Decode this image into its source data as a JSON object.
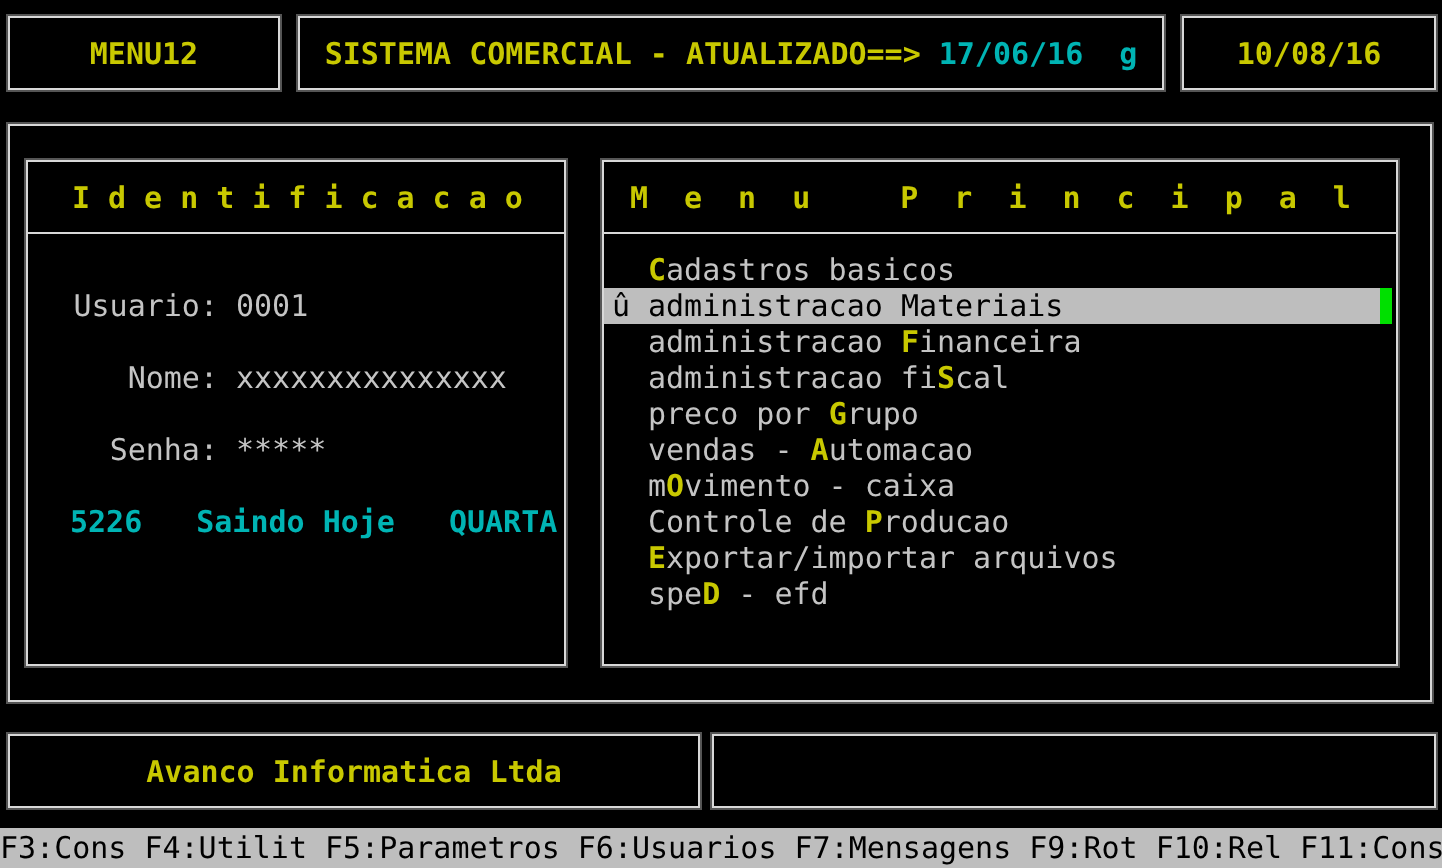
{
  "header": {
    "menu_code": "MENU12",
    "title": "SISTEMA COMERCIAL - ATUALIZADO==>",
    "updated_date": "17/06/16",
    "flag": "g",
    "current_date": "10/08/16"
  },
  "identification": {
    "title": "Identificacao",
    "fields": [
      {
        "label": "Usuario:",
        "value": "0001"
      },
      {
        "label": "Nome:",
        "value": "xxxxxxxxxxxxxxx"
      },
      {
        "label": "Senha:",
        "value": "*****"
      }
    ],
    "status": [
      "5226",
      "Saindo Hoje",
      "QUARTA"
    ]
  },
  "main_menu": {
    "title": "Menu Principal",
    "cursor_marker": "û",
    "items": [
      {
        "label": "**C**adastros basicos",
        "selected": false
      },
      {
        "label": "administracao **M**ateriais",
        "selected": true
      },
      {
        "label": "administracao **F**inanceira",
        "selected": false
      },
      {
        "label": "administracao fi**S**cal",
        "selected": false
      },
      {
        "label": "preco por **G**rupo",
        "selected": false
      },
      {
        "label": "vendas - **A**utomacao",
        "selected": false
      },
      {
        "label": "m**O**vimento - caixa",
        "selected": false
      },
      {
        "label": "Controle de **P**roducao",
        "selected": false
      },
      {
        "label": "**E**xportar/importar arquivos",
        "selected": false
      },
      {
        "label": "spe**D** - efd",
        "selected": false
      }
    ]
  },
  "footer": {
    "company": "Avanco Informatica Ltda"
  },
  "function_keys": [
    "F3:Cons",
    "F4:Utilit",
    "F5:Parametros",
    "F6:Usuarios",
    "F7:Mensagens",
    "F9:Rot",
    "F10:Rel",
    "F11:Cons"
  ]
}
